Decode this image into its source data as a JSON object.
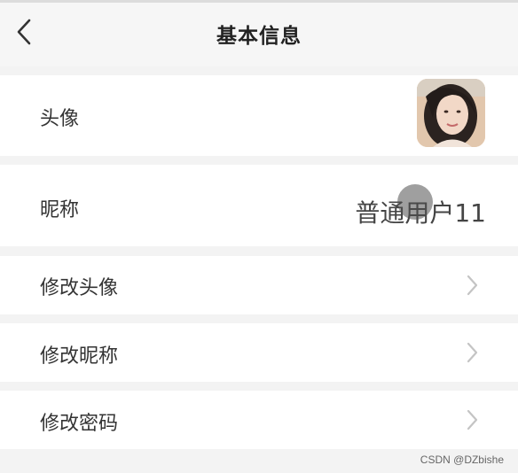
{
  "header": {
    "title": "基本信息",
    "back_icon": "chevron-left-icon"
  },
  "profile": {
    "avatar_label": "头像",
    "nickname_label": "昵称",
    "nickname_value": "普通用户11"
  },
  "menu": [
    {
      "label": "修改头像",
      "icon": "chevron-right-icon"
    },
    {
      "label": "修改昵称",
      "icon": "chevron-right-icon"
    },
    {
      "label": "修改密码",
      "icon": "chevron-right-icon"
    }
  ],
  "watermark": "CSDN @DZbishe",
  "colors": {
    "background": "#f3f3f3",
    "card": "#ffffff",
    "text": "#333333",
    "chevron": "#c4c4c4"
  }
}
